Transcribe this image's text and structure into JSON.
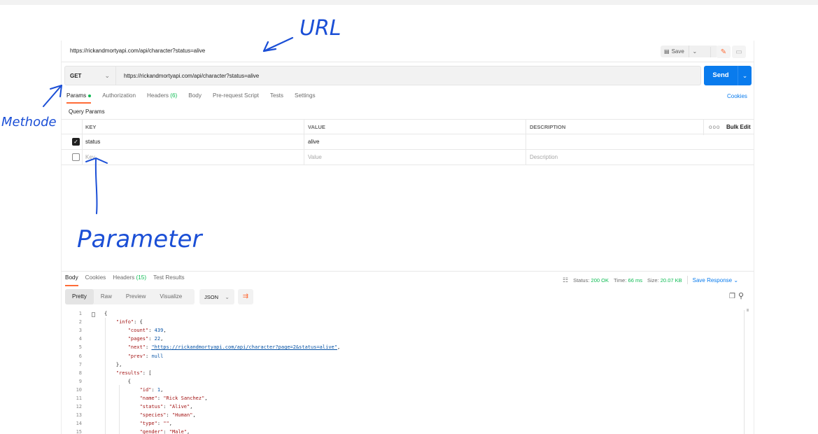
{
  "request": {
    "tab_url": "https://rickandmortyapi.com/api/character?status=alive",
    "save_label": "Save",
    "method": "GET",
    "url": "https://rickandmortyapi.com/api/character?status=alive",
    "send_label": "Send"
  },
  "request_tabs": {
    "params": "Params",
    "authorization": "Authorization",
    "headers": "Headers",
    "headers_count": "(6)",
    "body": "Body",
    "pre_request": "Pre-request Script",
    "tests": "Tests",
    "settings": "Settings",
    "cookies": "Cookies"
  },
  "params": {
    "title": "Query Params",
    "headers": {
      "key": "KEY",
      "value": "VALUE",
      "description": "DESCRIPTION",
      "bulk_edit": "Bulk Edit",
      "more": "ooo"
    },
    "rows": [
      {
        "checked": true,
        "key": "status",
        "value": "alive"
      }
    ],
    "placeholders": {
      "key": "Key",
      "value": "Value",
      "description": "Description"
    }
  },
  "response": {
    "tabs": {
      "body": "Body",
      "cookies": "Cookies",
      "headers": "Headers",
      "headers_count": "(15)",
      "tests": "Test Results"
    },
    "status_label": "Status:",
    "status_value": "200 OK",
    "time_label": "Time:",
    "time_value": "66 ms",
    "size_label": "Size:",
    "size_value": "20.07 KB",
    "save_response": "Save Response",
    "views": {
      "pretty": "Pretty",
      "raw": "Raw",
      "preview": "Preview",
      "visualize": "Visualize"
    },
    "format": "JSON"
  },
  "code_lines": [
    {
      "n": "1",
      "t": "{"
    },
    {
      "n": "2",
      "t": "    \"info\": {"
    },
    {
      "n": "3",
      "t": "        \"count\": 439,"
    },
    {
      "n": "4",
      "t": "        \"pages\": 22,"
    },
    {
      "n": "5",
      "t": "        \"next\": \"https://rickandmortyapi.com/api/character?page=2&status=alive\","
    },
    {
      "n": "6",
      "t": "        \"prev\": null"
    },
    {
      "n": "7",
      "t": "    },"
    },
    {
      "n": "8",
      "t": "    \"results\": ["
    },
    {
      "n": "9",
      "t": "        {"
    },
    {
      "n": "10",
      "t": "            \"id\": 1,"
    },
    {
      "n": "11",
      "t": "            \"name\": \"Rick Sanchez\","
    },
    {
      "n": "12",
      "t": "            \"status\": \"Alive\","
    },
    {
      "n": "13",
      "t": "            \"species\": \"Human\","
    },
    {
      "n": "14",
      "t": "            \"type\": \"\","
    },
    {
      "n": "15",
      "t": "            \"gender\": \"Male\","
    }
  ],
  "annotations": {
    "url": "URL",
    "methode": "Methode",
    "parameter": "Parameter"
  },
  "colors": {
    "accent": "#ff6c37",
    "send": "#097bed",
    "success": "#0cbb52",
    "ink": "#1b4fd6"
  }
}
